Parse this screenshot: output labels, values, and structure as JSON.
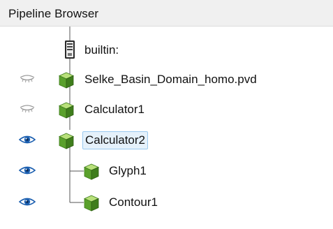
{
  "panel": {
    "title": "Pipeline Browser"
  },
  "tree": {
    "items": [
      {
        "label": "builtin:",
        "icon": "server-icon",
        "visibility": "none",
        "selected": false
      },
      {
        "label": "Selke_Basin_Domain_homo.pvd",
        "icon": "dataset-cube-icon",
        "visibility": "hidden",
        "selected": false
      },
      {
        "label": "Calculator1",
        "icon": "filter-cube-icon",
        "visibility": "hidden",
        "selected": false
      },
      {
        "label": "Calculator2",
        "icon": "filter-cube-icon",
        "visibility": "visible",
        "selected": true
      },
      {
        "label": "Glyph1",
        "icon": "filter-cube-icon",
        "visibility": "visible",
        "selected": false
      },
      {
        "label": "Contour1",
        "icon": "filter-cube-icon",
        "visibility": "visible",
        "selected": false
      }
    ]
  },
  "colors": {
    "cube_top": "#b8e07a",
    "cube_left": "#5aa02c",
    "cube_right": "#3f7d1c",
    "eye_open": "#1b5fb0",
    "eye_closed": "#9a9a9a",
    "selection_bg": "#e5f1fb",
    "selection_border": "#99c9ef",
    "tree_lines": "#555555"
  }
}
